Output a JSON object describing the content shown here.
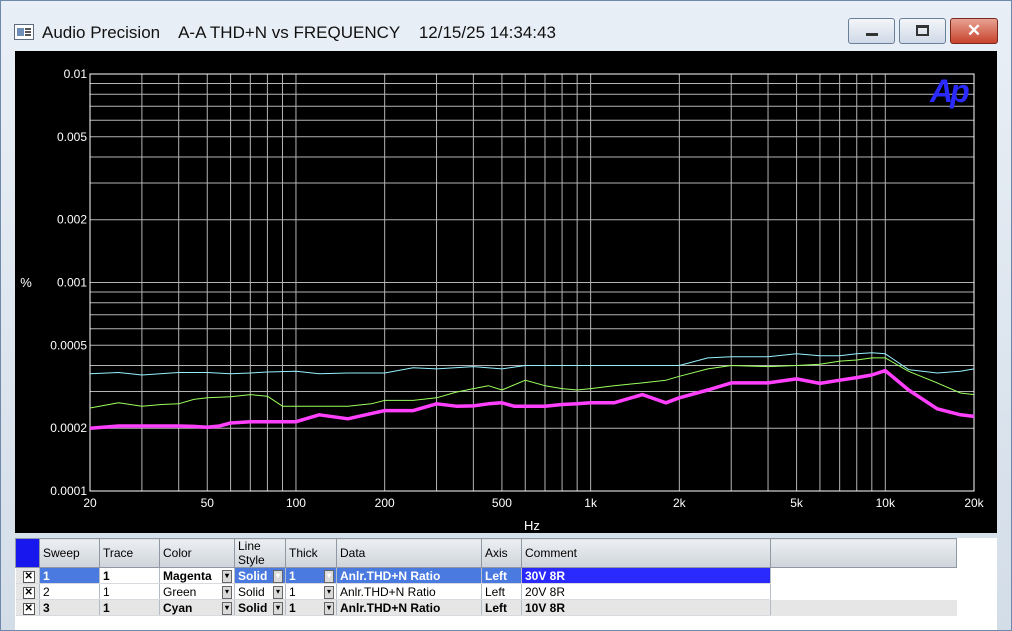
{
  "window": {
    "app_name": "Audio Precision",
    "graph_title": "A-A THD+N vs FREQUENCY",
    "datetime": "12/15/25 14:34:43"
  },
  "chart_data": {
    "type": "line",
    "title": "",
    "xlabel": "Hz",
    "ylabel": "%",
    "x_scale": "log",
    "y_scale": "log",
    "xlim": [
      20,
      20000
    ],
    "ylim": [
      0.0001,
      0.01
    ],
    "x_ticks": [
      "20",
      "50",
      "100",
      "200",
      "500",
      "1k",
      "2k",
      "5k",
      "10k",
      "20k"
    ],
    "y_ticks": [
      "0.01",
      "0.005",
      "0.002",
      "0.001",
      "0.0005",
      "0.0002",
      "0.0001"
    ],
    "grid": true,
    "logo": "Ap",
    "colors": {
      "background": "#000000",
      "grid": "#b4b4b4",
      "text": "#ffffff",
      "logo": "#2a2aff"
    },
    "series": [
      {
        "name": "30V 8R",
        "color": "#ff40ff",
        "width": 3.5,
        "x": [
          20,
          25,
          30,
          35,
          40,
          45,
          50,
          55,
          60,
          70,
          80,
          90,
          100,
          120,
          150,
          180,
          200,
          250,
          300,
          350,
          400,
          450,
          500,
          550,
          600,
          700,
          800,
          900,
          1000,
          1200,
          1500,
          1800,
          2000,
          2500,
          3000,
          4000,
          5000,
          6000,
          7000,
          8000,
          9000,
          10000,
          12000,
          15000,
          18000,
          20000
        ],
        "y": [
          0.0002,
          0.000205,
          0.000205,
          0.000205,
          0.000205,
          0.000204,
          0.000202,
          0.000205,
          0.000212,
          0.000215,
          0.000215,
          0.000215,
          0.000215,
          0.000232,
          0.000222,
          0.000235,
          0.000243,
          0.000243,
          0.000262,
          0.000255,
          0.000256,
          0.000262,
          0.000265,
          0.000255,
          0.000255,
          0.000255,
          0.00026,
          0.000262,
          0.000265,
          0.000265,
          0.00029,
          0.000265,
          0.00028,
          0.000305,
          0.00033,
          0.00033,
          0.000345,
          0.000328,
          0.00034,
          0.00035,
          0.00036,
          0.000378,
          0.000305,
          0.000248,
          0.000232,
          0.000228
        ]
      },
      {
        "name": "20V 8R",
        "color": "#9cff5c",
        "width": 1,
        "x": [
          20,
          25,
          30,
          35,
          40,
          45,
          50,
          60,
          70,
          80,
          90,
          100,
          130,
          150,
          180,
          200,
          250,
          300,
          350,
          400,
          450,
          500,
          600,
          700,
          800,
          900,
          1000,
          1200,
          1500,
          1800,
          2000,
          2500,
          3000,
          4000,
          5000,
          6000,
          7000,
          8000,
          9000,
          10000,
          12000,
          15000,
          18000,
          20000
        ],
        "y": [
          0.00025,
          0.000265,
          0.000255,
          0.00026,
          0.000262,
          0.000275,
          0.00028,
          0.000283,
          0.00029,
          0.000285,
          0.000255,
          0.000255,
          0.000255,
          0.000255,
          0.000262,
          0.000272,
          0.000272,
          0.00028,
          0.000298,
          0.00031,
          0.00032,
          0.000305,
          0.00034,
          0.00032,
          0.00031,
          0.000305,
          0.00031,
          0.00032,
          0.00033,
          0.00034,
          0.000355,
          0.000385,
          0.0004,
          0.000395,
          0.0004,
          0.000405,
          0.00042,
          0.000425,
          0.000435,
          0.000435,
          0.000375,
          0.00033,
          0.000295,
          0.00029
        ]
      },
      {
        "name": "10V 8R",
        "color": "#96f0ff",
        "width": 1,
        "x": [
          20,
          25,
          30,
          40,
          50,
          60,
          70,
          80,
          100,
          120,
          150,
          200,
          250,
          300,
          400,
          500,
          600,
          700,
          800,
          900,
          1000,
          1200,
          1500,
          2000,
          2500,
          3000,
          4000,
          5000,
          6000,
          7000,
          8000,
          9000,
          10000,
          12000,
          15000,
          18000,
          20000
        ],
        "y": [
          0.000365,
          0.00037,
          0.00036,
          0.00037,
          0.00037,
          0.000365,
          0.000368,
          0.000372,
          0.000375,
          0.000365,
          0.000368,
          0.000368,
          0.00039,
          0.000385,
          0.000395,
          0.000385,
          0.0004,
          0.0004,
          0.0004,
          0.0004,
          0.0004,
          0.0004,
          0.0004,
          0.0004,
          0.000435,
          0.00044,
          0.00044,
          0.000455,
          0.000445,
          0.000445,
          0.000455,
          0.00046,
          0.000455,
          0.000382,
          0.000368,
          0.000375,
          0.000385
        ]
      }
    ]
  },
  "legend_table": {
    "corner_color": "#1818ee",
    "columns": [
      "Sweep",
      "Trace",
      "Color",
      "Line Style",
      "Thick",
      "Data",
      "Axis",
      "Comment"
    ],
    "rows": [
      {
        "checked": true,
        "sweep": "1",
        "trace": "1",
        "color": "Magenta",
        "line_style": "Solid",
        "thick": "1",
        "data": "Anlr.THD+N Ratio",
        "axis": "Left",
        "comment": "30V 8R"
      },
      {
        "checked": true,
        "sweep": "2",
        "trace": "1",
        "color": "Green",
        "line_style": "Solid",
        "thick": "1",
        "data": "Anlr.THD+N Ratio",
        "axis": "Left",
        "comment": "20V 8R"
      },
      {
        "checked": true,
        "sweep": "3",
        "trace": "1",
        "color": "Cyan",
        "line_style": "Solid",
        "thick": "1",
        "data": "Anlr.THD+N Ratio",
        "axis": "Left",
        "comment": "10V 8R"
      }
    ]
  }
}
